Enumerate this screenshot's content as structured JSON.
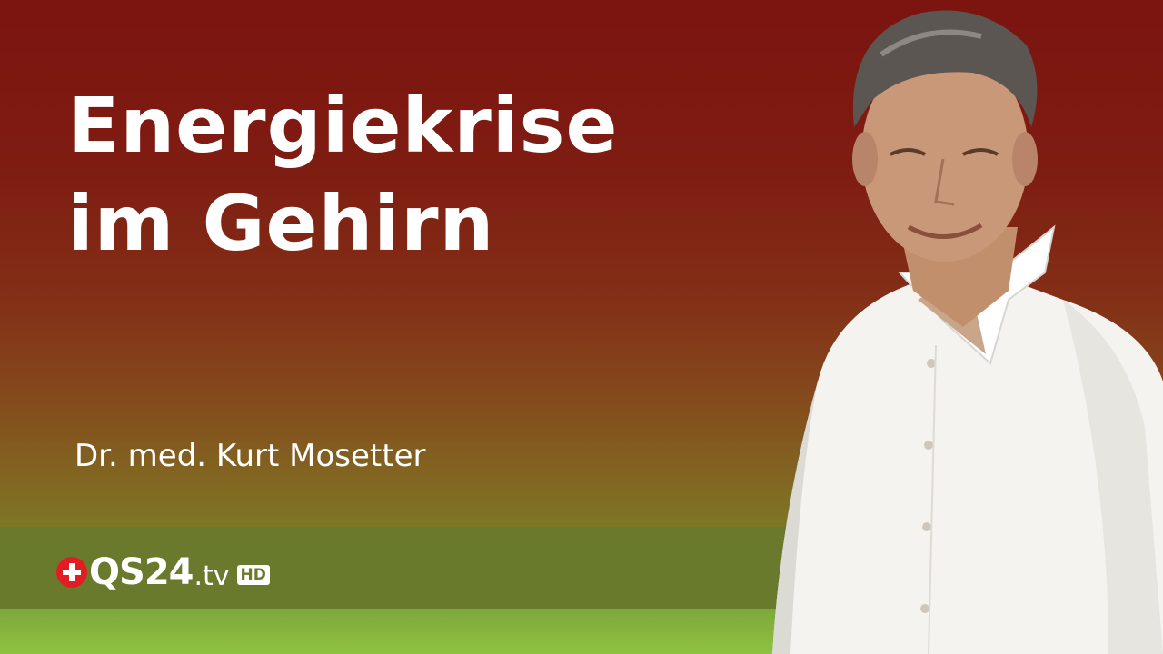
{
  "headline": {
    "line1": "Energiekrise",
    "line2": "im Gehirn"
  },
  "speaker": "Dr. med. Kurt Mosetter",
  "logo": {
    "name": "QS24",
    "suffix": ".tv",
    "badge": "HD",
    "icon": "swiss-cross-icon"
  },
  "portrait": {
    "icon": "person-photo"
  },
  "colors": {
    "background_top": "#7c1410",
    "background_mid": "#85481c",
    "background_bottom": "#7c7a26",
    "band_dark": "#697a2c",
    "band_light": "#8ec241",
    "cross_red": "#e31c23",
    "text": "#ffffff"
  }
}
